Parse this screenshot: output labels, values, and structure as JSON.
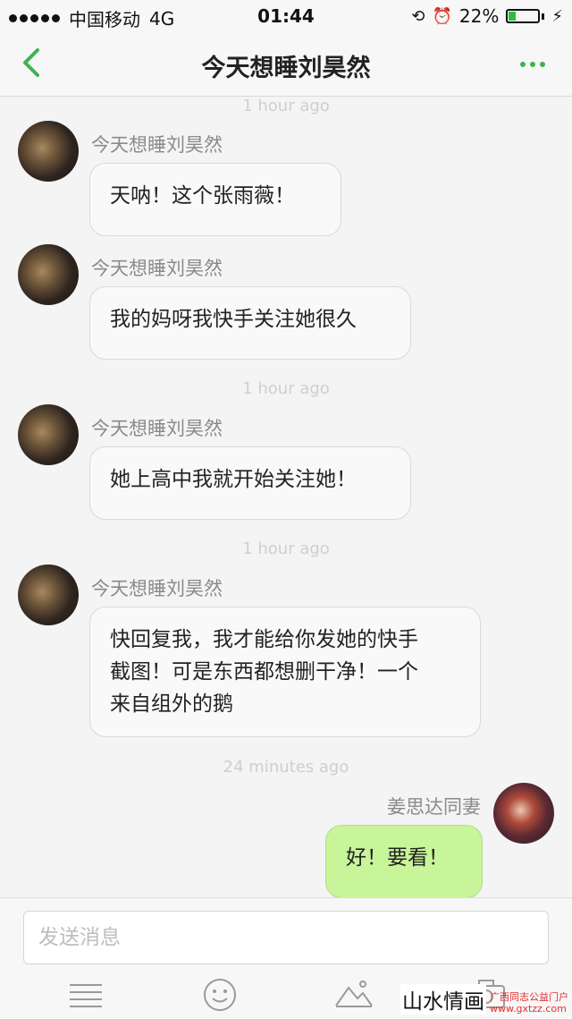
{
  "status_bar": {
    "carrier": "中国移动",
    "network": "4G",
    "time": "01:44",
    "battery_pct": "22%",
    "battery_level": 0.22
  },
  "nav": {
    "title": "今天想睡刘昊然",
    "back_icon": "chevron-left-icon",
    "more_icon": "more-dots-icon",
    "accent": "#3fb34f"
  },
  "timestamps": [
    "1 hour ago",
    "1 hour ago",
    "1 hour ago",
    "24 minutes ago"
  ],
  "messages": [
    {
      "sender": "今天想睡刘昊然",
      "text": "天呐！这个张雨薇！"
    },
    {
      "sender": "今天想睡刘昊然",
      "text": "我的妈呀我快手关注她很久"
    },
    {
      "sender": "今天想睡刘昊然",
      "text": "她上高中我就开始关注她！"
    },
    {
      "sender": "今天想睡刘昊然",
      "lines": [
        "快回复我，我才能给你发她的快手",
        "截图！可是东西都想删干净！一个",
        "来自组外的鹅"
      ]
    },
    {
      "sender": "姜思达同妻",
      "text": "好！要看！"
    }
  ],
  "input": {
    "placeholder": "发送消息"
  },
  "toolbar": {
    "icons": [
      "list-icon",
      "emoji-icon",
      "image-icon",
      "camera-icon"
    ]
  },
  "watermark": {
    "main": "山水情画",
    "site_name": "广西同志公益门户",
    "site_url": "www.gxtzz.com"
  },
  "colors": {
    "bubble_mine": "#c8f59a",
    "bubble_other": "#f9f9f9",
    "battery": "#2fbd3f"
  }
}
